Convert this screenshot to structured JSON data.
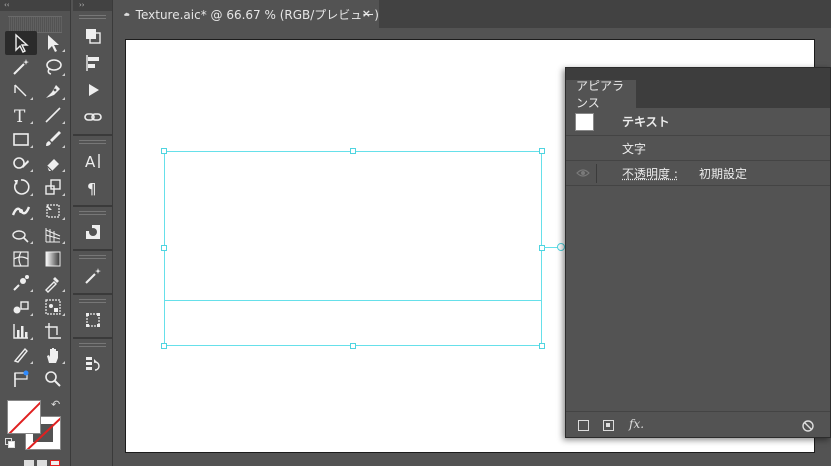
{
  "tools_panel": {
    "collapse_glyph": "‹‹",
    "tools": [
      {
        "name": "selection-tool-icon",
        "active": true
      },
      {
        "name": "direct-selection-tool-icon"
      },
      {
        "name": "magic-wand-tool-icon"
      },
      {
        "name": "lasso-tool-icon"
      },
      {
        "name": "pen-tool-icon"
      },
      {
        "name": "curvature-tool-icon"
      },
      {
        "name": "type-tool-icon"
      },
      {
        "name": "line-segment-tool-icon"
      },
      {
        "name": "rectangle-tool-icon"
      },
      {
        "name": "paintbrush-tool-icon"
      },
      {
        "name": "shaper-tool-icon"
      },
      {
        "name": "eraser-tool-icon"
      },
      {
        "name": "rotate-tool-icon"
      },
      {
        "name": "scale-tool-icon"
      },
      {
        "name": "width-tool-icon"
      },
      {
        "name": "free-transform-tool-icon"
      },
      {
        "name": "shape-builder-tool-icon"
      },
      {
        "name": "perspective-grid-tool-icon"
      },
      {
        "name": "mesh-tool-icon"
      },
      {
        "name": "gradient-tool-icon"
      },
      {
        "name": "blend-tool-icon"
      },
      {
        "name": "eyedropper-tool-icon"
      },
      {
        "name": "symbol-sprayer-tool-icon"
      },
      {
        "name": "symbol-tool-icon"
      },
      {
        "name": "column-graph-tool-icon"
      },
      {
        "name": "artboard-tool-icon"
      },
      {
        "name": "slice-tool-icon"
      },
      {
        "name": "hand-tool-icon"
      },
      {
        "name": "puppet-warp-tool-icon"
      },
      {
        "name": "zoom-tool-icon"
      }
    ]
  },
  "panel2": {
    "collapse_glyph": "››"
  },
  "document_tab": {
    "title": "Texture.aic* @ 66.67 % (RGB/プレビュー)",
    "close": "×"
  },
  "appearance_panel": {
    "tab_label": "アピアランス",
    "rows": {
      "object_label": "テキスト",
      "characters_label": "文字",
      "opacity_label": "不透明度 :",
      "opacity_value": "初期設定"
    },
    "bottom": {
      "fx_label": "fx."
    }
  },
  "colors": {
    "ui_background": "#535353",
    "selection": "#66e0ea",
    "artboard": "#ffffff"
  }
}
